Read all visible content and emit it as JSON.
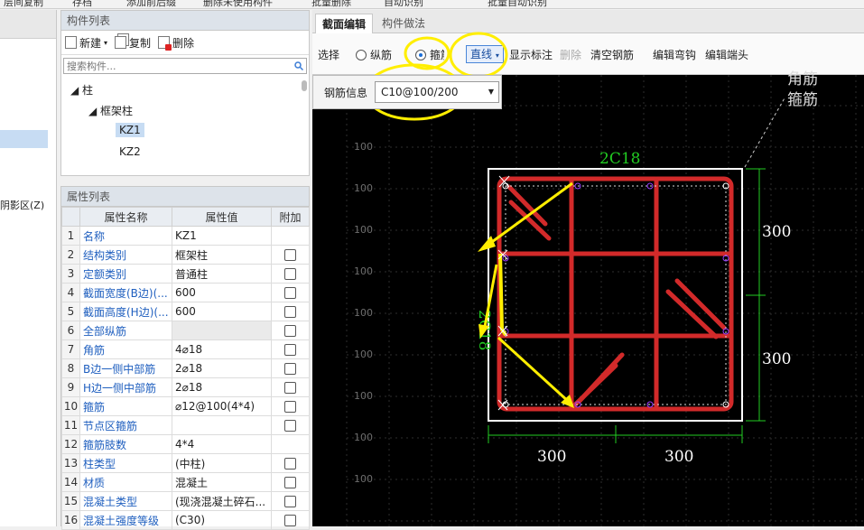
{
  "topbar": [
    "层间复制",
    "存档",
    "添加前后缀",
    "删除未使用构件",
    "批量删除",
    "自动识别",
    "批量自动识别"
  ],
  "leftnav": {
    "label": "阴影区(Z)"
  },
  "component_panel": {
    "title": "构件列表",
    "new_label": "新建",
    "copy_label": "复制",
    "delete_label": "删除",
    "search_placeholder": "搜索构件...",
    "tree": {
      "root": "柱",
      "child": "框架柱",
      "items": [
        "KZ1",
        "KZ2"
      ]
    }
  },
  "property_panel": {
    "title": "属性列表",
    "headers": [
      "属性名称",
      "属性值",
      "附加"
    ],
    "rows": [
      {
        "n": "1",
        "name": "名称",
        "value": "KZ1",
        "cb": false
      },
      {
        "n": "2",
        "name": "结构类别",
        "value": "框架柱",
        "cb": true
      },
      {
        "n": "3",
        "name": "定额类别",
        "value": "普通柱",
        "cb": true
      },
      {
        "n": "4",
        "name": "截面宽度(B边)(...",
        "value": "600",
        "cb": true
      },
      {
        "n": "5",
        "name": "截面高度(H边)(...",
        "value": "600",
        "cb": true
      },
      {
        "n": "6",
        "name": "全部纵筋",
        "value": "",
        "cb": true,
        "gray": true
      },
      {
        "n": "7",
        "name": "角筋",
        "value": "4⌀18",
        "cb": true
      },
      {
        "n": "8",
        "name": "B边一侧中部筋",
        "value": "2⌀18",
        "cb": true
      },
      {
        "n": "9",
        "name": "H边一侧中部筋",
        "value": "2⌀18",
        "cb": true
      },
      {
        "n": "10",
        "name": "箍筋",
        "value": "⌀12@100(4*4)",
        "cb": true
      },
      {
        "n": "11",
        "name": "节点区箍筋",
        "value": "",
        "cb": true
      },
      {
        "n": "12",
        "name": "箍筋肢数",
        "value": "4*4",
        "cb": false
      },
      {
        "n": "13",
        "name": "柱类型",
        "value": "(中柱)",
        "cb": true
      },
      {
        "n": "14",
        "name": "材质",
        "value": "混凝土",
        "cb": true
      },
      {
        "n": "15",
        "name": "混凝土类型",
        "value": "(现浇混凝土碎石...",
        "cb": true
      },
      {
        "n": "16",
        "name": "混凝土强度等级",
        "value": "(C30)",
        "cb": true
      }
    ]
  },
  "editor": {
    "tabs": [
      "截面编辑",
      "构件做法"
    ],
    "toolbar": {
      "select": "选择",
      "longitudinal": "纵筋",
      "stirrup": "箍筋",
      "line_mode": "直线",
      "show_label": "显示标注",
      "delete": "删除",
      "clear": "清空钢筋",
      "edit_hook": "编辑弯钩",
      "edit_end": "编辑端头"
    },
    "rebar_info_label": "钢筋信息",
    "rebar_info_value": "C10@100/200"
  },
  "drawing": {
    "grid_label": "100",
    "grid_label_count": 9,
    "top_rebar": "2C18",
    "side_rebar": "2C18",
    "dim_right": [
      "300",
      "300"
    ],
    "dim_bottom": [
      "300",
      "300"
    ],
    "legend": [
      "角筋",
      "箍筋"
    ],
    "colors": {
      "rebar": "#d22a2a",
      "dimension": "#22cc22",
      "highlight": "#ffee00",
      "arrow": "#ffee00",
      "section": "#ffffff"
    }
  }
}
